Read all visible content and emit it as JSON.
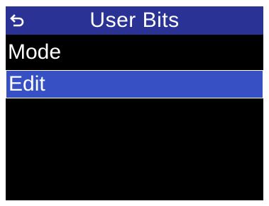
{
  "header": {
    "title": "User Bits",
    "back_icon": "back-arrow-icon"
  },
  "menu": {
    "items": [
      {
        "label": "Mode",
        "selected": false
      },
      {
        "label": "Edit",
        "selected": true
      }
    ]
  },
  "colors": {
    "screen_bg": "#000000",
    "title_bar": "#2a3296",
    "selection": "#3751c5",
    "text": "#ffffff"
  }
}
